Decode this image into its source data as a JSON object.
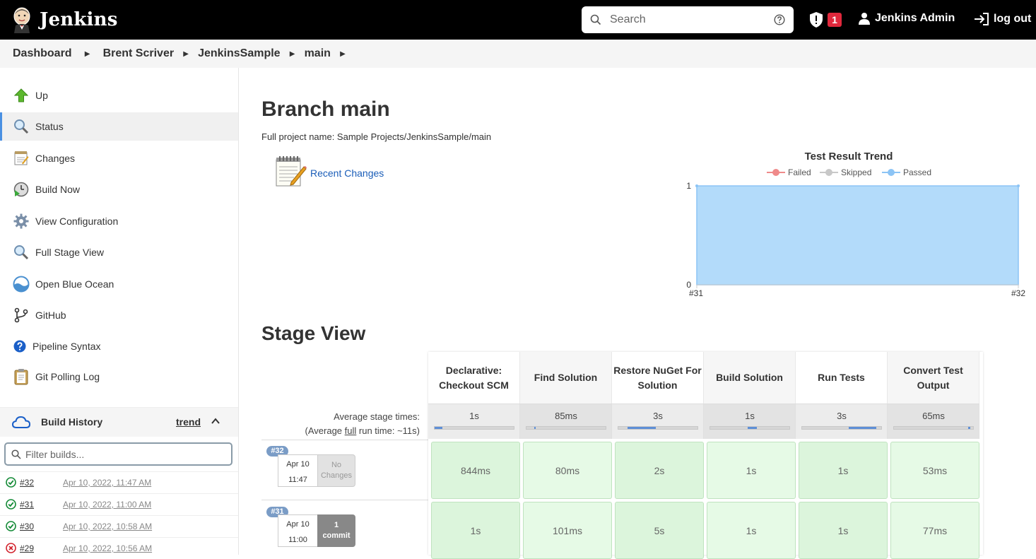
{
  "header": {
    "logo_text": "Jenkins",
    "search_placeholder": "Search",
    "alert_count": "1",
    "user_name": "Jenkins Admin",
    "logout_label": "log out"
  },
  "breadcrumb": [
    "Dashboard",
    "Brent Scriver",
    "JenkinsSample",
    "main"
  ],
  "sidebar": {
    "tasks": [
      {
        "label": "Up",
        "icon": "up-arrow-icon"
      },
      {
        "label": "Status",
        "icon": "magnifier-icon"
      },
      {
        "label": "Changes",
        "icon": "notepad-icon"
      },
      {
        "label": "Build Now",
        "icon": "clock-play-icon"
      },
      {
        "label": "View Configuration",
        "icon": "gear-icon"
      },
      {
        "label": "Full Stage View",
        "icon": "magnifier-icon"
      },
      {
        "label": "Open Blue Ocean",
        "icon": "blue-ocean-icon"
      },
      {
        "label": "GitHub",
        "icon": "git-branch-icon"
      },
      {
        "label": "Pipeline Syntax",
        "icon": "help-icon"
      },
      {
        "label": "Git Polling Log",
        "icon": "clipboard-icon"
      }
    ],
    "build_history_title": "Build History",
    "trend_label": "trend",
    "filter_placeholder": "Filter builds...",
    "builds": [
      {
        "number": "#32",
        "date": "Apr 10, 2022, 11:47 AM",
        "status": "success"
      },
      {
        "number": "#31",
        "date": "Apr 10, 2022, 11:00 AM",
        "status": "success"
      },
      {
        "number": "#30",
        "date": "Apr 10, 2022, 10:58 AM",
        "status": "success"
      },
      {
        "number": "#29",
        "date": "Apr 10, 2022, 10:56 AM",
        "status": "failure"
      }
    ]
  },
  "main": {
    "title": "Branch main",
    "full_project_name": "Full project name: Sample Projects/JenkinsSample/main",
    "recent_changes": "Recent Changes"
  },
  "chart_data": {
    "type": "area",
    "title": "Test Result Trend",
    "legend": [
      "Failed",
      "Skipped",
      "Passed"
    ],
    "legend_placement": "top",
    "categories": [
      "#31",
      "#32"
    ],
    "series": [
      {
        "name": "Failed",
        "values": [
          0,
          0
        ]
      },
      {
        "name": "Skipped",
        "values": [
          0,
          0
        ]
      },
      {
        "name": "Passed",
        "values": [
          1,
          1
        ]
      }
    ],
    "y_ticks": [
      "0",
      "1"
    ],
    "ylim": [
      0,
      1
    ],
    "colors": {
      "Failed": "#ef8a8a",
      "Skipped": "#c8c8c8",
      "Passed": "#8cc4f5",
      "fill": "#b3dbfa"
    }
  },
  "stage_view": {
    "title": "Stage View",
    "avg_label": "Average stage times:",
    "avg_full_prefix": "(Average ",
    "avg_full_link": "full",
    "avg_full_suffix": " run time: ~11s)",
    "stages": [
      {
        "name": "Declarative: Checkout SCM",
        "avg": "1s",
        "bar": [
          0.0,
          0.1
        ]
      },
      {
        "name": "Find Solution",
        "avg": "85ms",
        "bar": [
          0.1,
          0.12
        ]
      },
      {
        "name": "Restore NuGet For Solution",
        "avg": "3s",
        "bar": [
          0.12,
          0.47
        ]
      },
      {
        "name": "Build Solution",
        "avg": "1s",
        "bar": [
          0.47,
          0.59
        ]
      },
      {
        "name": "Run Tests",
        "avg": "3s",
        "bar": [
          0.59,
          0.94
        ]
      },
      {
        "name": "Convert Test Output",
        "avg": "65ms",
        "bar": [
          0.94,
          0.96
        ]
      }
    ],
    "runs": [
      {
        "badge": "#32",
        "date": "Apr 10",
        "time": "11:47",
        "changes": "No Changes",
        "changes_type": "none",
        "times": [
          "844ms",
          "80ms",
          "2s",
          "1s",
          "1s",
          "53ms"
        ]
      },
      {
        "badge": "#31",
        "date": "Apr 10",
        "time": "11:00",
        "changes_count": "1",
        "changes_word": "commit",
        "changes_type": "commit",
        "times": [
          "1s",
          "101ms",
          "5s",
          "1s",
          "1s",
          "77ms"
        ]
      }
    ]
  }
}
